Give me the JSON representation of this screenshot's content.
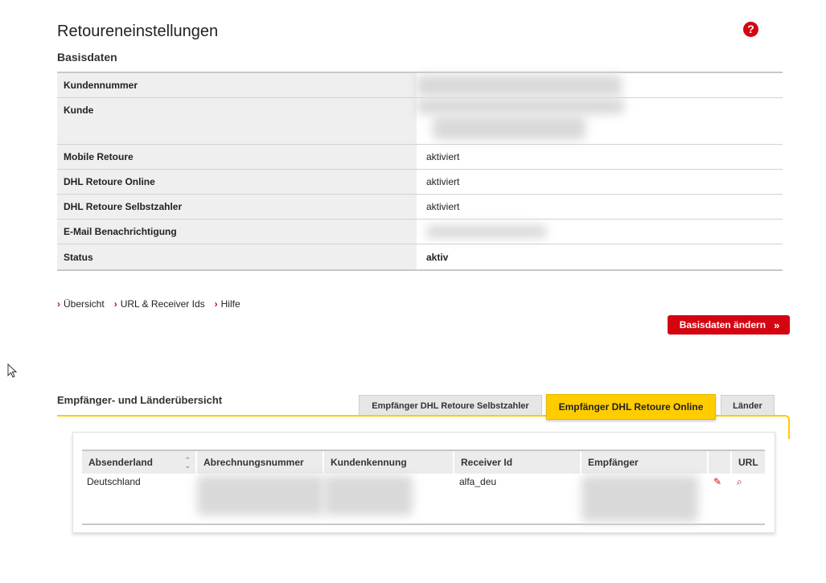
{
  "page": {
    "title": "Retoureneinstellungen",
    "help_glyph": "?"
  },
  "basisdaten": {
    "title": "Basisdaten",
    "rows": [
      {
        "label": "Kundennummer",
        "value": ""
      },
      {
        "label": "Kunde",
        "value": ""
      },
      {
        "label": "Mobile Retoure",
        "value": "aktiviert"
      },
      {
        "label": "DHL Retoure Online",
        "value": "aktiviert"
      },
      {
        "label": "DHL Retoure Selbstzahler",
        "value": "aktiviert"
      },
      {
        "label": "E-Mail Benachrichtigung",
        "value": ""
      },
      {
        "label": "Status",
        "value": "aktiv"
      }
    ]
  },
  "links": [
    {
      "label": "Übersicht"
    },
    {
      "label": "URL & Receiver Ids"
    },
    {
      "label": "Hilfe"
    }
  ],
  "edit_button": {
    "label": "Basisdaten ändern",
    "glyph": "»"
  },
  "overview": {
    "title": "Empfänger- und Länderübersicht",
    "tabs": [
      {
        "label": "Empfänger DHL Retoure Selbstzahler",
        "active": false
      },
      {
        "label": "Empfänger DHL Retoure Online",
        "active": true
      },
      {
        "label": "Länder",
        "active": false
      }
    ],
    "columns": [
      "Absenderland",
      "Abrechnungsnummer",
      "Kundenkennung",
      "Receiver Id",
      "Empfänger",
      "",
      "URL"
    ],
    "rows": [
      {
        "absenderland": "Deutschland",
        "abrechnungsnummer": "",
        "kundenkennung": "",
        "receiver_id": "alfa_deu",
        "empfaenger": ""
      }
    ]
  },
  "colors": {
    "accent_red": "#d40511",
    "accent_yellow": "#ffcc00"
  }
}
